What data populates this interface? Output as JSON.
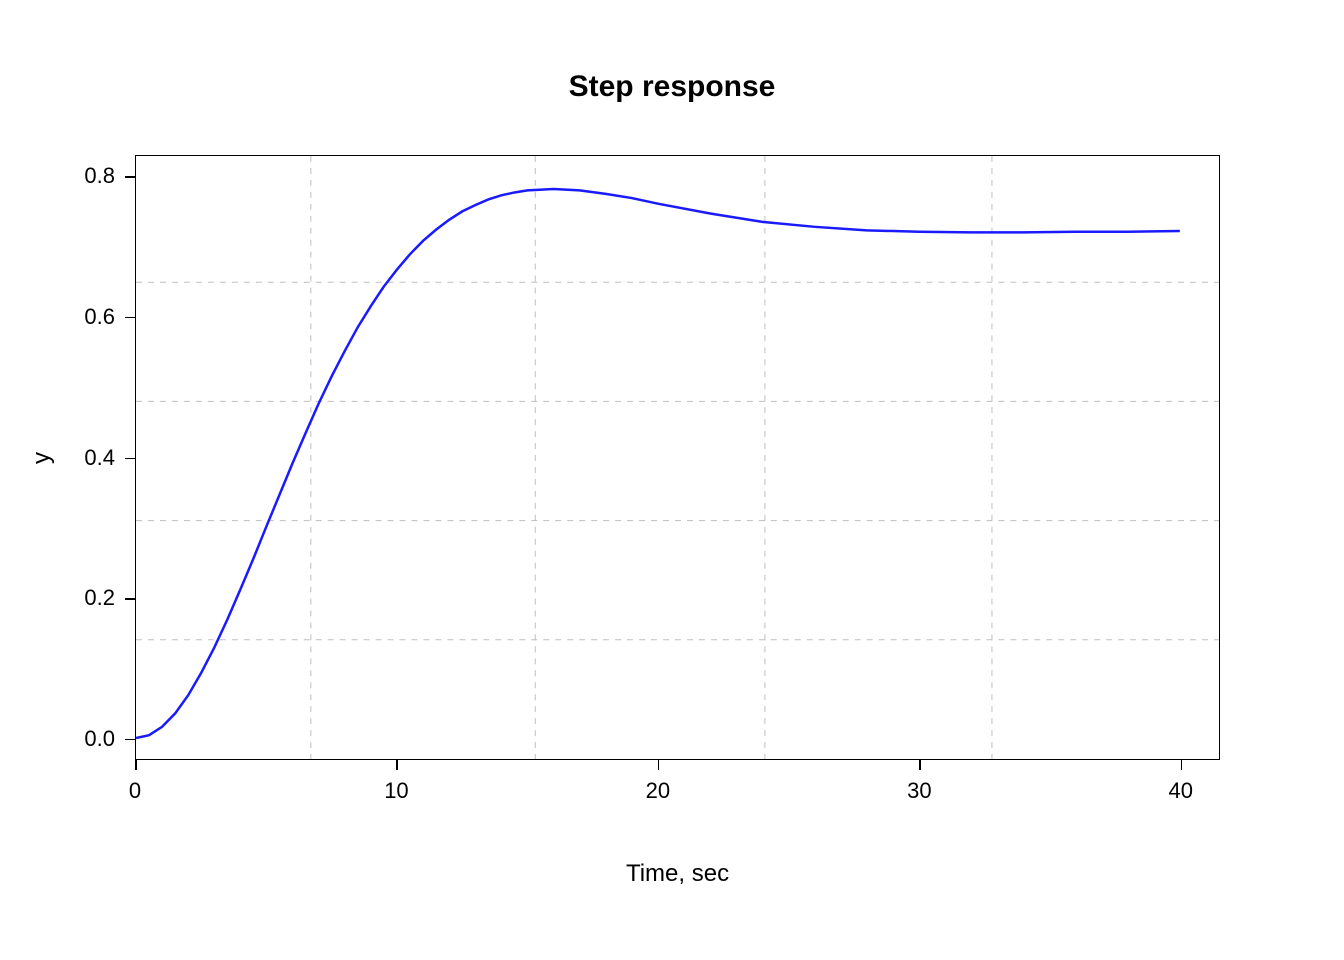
{
  "chart_data": {
    "type": "line",
    "title": "Step response",
    "xlabel": "Time, sec",
    "ylabel": "y",
    "xlim": [
      0,
      40
    ],
    "ylim": [
      0.0,
      0.8
    ],
    "x_ticks": [
      0,
      10,
      20,
      30,
      40
    ],
    "y_ticks": [
      0.0,
      0.2,
      0.4,
      0.6,
      0.8
    ],
    "grid": true,
    "vgrid_x": [
      6.7,
      15.3,
      24.1,
      32.8
    ],
    "hgrid_y": [
      0.14,
      0.31,
      0.48,
      0.65
    ],
    "line_color": "#1a1aff",
    "x_plot_range": [
      0,
      41.5
    ],
    "y_plot_range": [
      -0.03,
      0.83
    ],
    "series": [
      {
        "name": "step-response",
        "x": [
          0,
          0.5,
          1,
          1.5,
          2,
          2.5,
          3,
          3.5,
          4,
          4.5,
          5,
          5.5,
          6,
          6.5,
          7,
          7.5,
          8,
          8.5,
          9,
          9.5,
          10,
          10.5,
          11,
          11.5,
          12,
          12.5,
          13,
          13.5,
          14,
          14.5,
          15,
          16,
          17,
          18,
          19,
          20,
          22,
          24,
          26,
          28,
          30,
          32,
          34,
          36,
          38,
          40
        ],
        "y": [
          0.0,
          0.004,
          0.016,
          0.035,
          0.061,
          0.093,
          0.129,
          0.169,
          0.212,
          0.256,
          0.302,
          0.347,
          0.392,
          0.435,
          0.477,
          0.516,
          0.552,
          0.586,
          0.616,
          0.644,
          0.668,
          0.69,
          0.709,
          0.725,
          0.739,
          0.751,
          0.76,
          0.768,
          0.774,
          0.778,
          0.781,
          0.783,
          0.781,
          0.776,
          0.77,
          0.762,
          0.748,
          0.736,
          0.729,
          0.724,
          0.722,
          0.721,
          0.721,
          0.722,
          0.722,
          0.723
        ]
      }
    ]
  }
}
